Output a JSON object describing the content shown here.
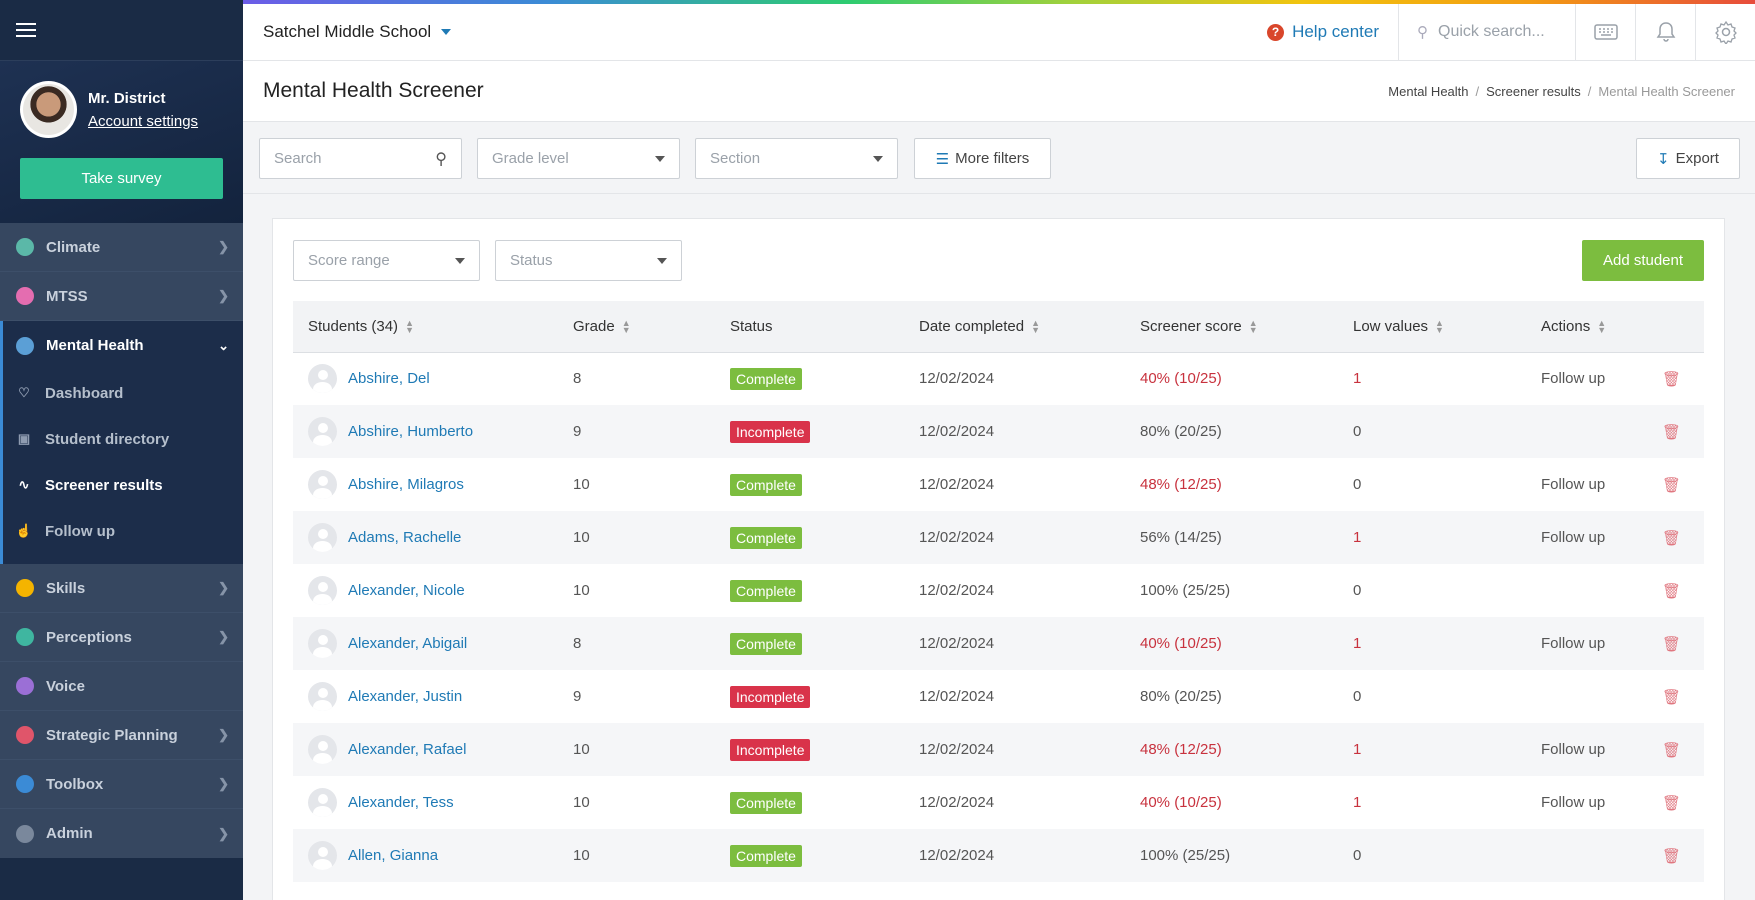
{
  "sidebar": {
    "user_name": "Mr. District",
    "account_link": "Account settings",
    "survey_button": "Take survey",
    "nav": [
      {
        "label": "Climate",
        "color": "#5bb8a8",
        "icon": "climate-icon"
      },
      {
        "label": "MTSS",
        "color": "#e46db0",
        "icon": "mtss-icon"
      },
      {
        "label": "Mental Health",
        "color": "#5b9fd6",
        "icon": "mental-health-icon"
      },
      {
        "label": "Skills",
        "color": "#f5b400",
        "icon": "skills-icon"
      },
      {
        "label": "Perceptions",
        "color": "#3fb6a0",
        "icon": "perceptions-icon"
      },
      {
        "label": "Voice",
        "color": "#9b6fd6",
        "icon": "voice-icon"
      },
      {
        "label": "Strategic Planning",
        "color": "#e0556a",
        "icon": "strategic-planning-icon"
      },
      {
        "label": "Toolbox",
        "color": "#3b8bd6",
        "icon": "toolbox-icon"
      },
      {
        "label": "Admin",
        "color": "#7a889c",
        "icon": "admin-icon"
      }
    ],
    "sub_nav": [
      {
        "label": "Dashboard"
      },
      {
        "label": "Student directory"
      },
      {
        "label": "Screener results"
      },
      {
        "label": "Follow up"
      }
    ]
  },
  "topbar": {
    "school": "Satchel Middle School",
    "help": "Help center",
    "search_placeholder": "Quick search..."
  },
  "page": {
    "title": "Mental Health Screener",
    "breadcrumb": [
      "Mental Health",
      "Screener results",
      "Mental Health Screener"
    ]
  },
  "filters": {
    "search_placeholder": "Search",
    "grade_level": "Grade level",
    "section": "Section",
    "more_filters": "More filters",
    "export": "Export",
    "score_range": "Score range",
    "status": "Status",
    "add_student": "Add student"
  },
  "table": {
    "headers": [
      "Students (34)",
      "Grade",
      "Status",
      "Date completed",
      "Screener score",
      "Low values",
      "Actions"
    ],
    "rows": [
      {
        "name": "Abshire, Del",
        "grade": "8",
        "status": "Complete",
        "date": "12/02/2024",
        "score": "40% (10/25)",
        "score_low": true,
        "low": "1",
        "action": "Follow up"
      },
      {
        "name": "Abshire, Humberto",
        "grade": "9",
        "status": "Incomplete",
        "date": "12/02/2024",
        "score": "80% (20/25)",
        "score_low": false,
        "low": "0",
        "action": ""
      },
      {
        "name": "Abshire, Milagros",
        "grade": "10",
        "status": "Complete",
        "date": "12/02/2024",
        "score": "48% (12/25)",
        "score_low": true,
        "low": "0",
        "action": "Follow up"
      },
      {
        "name": "Adams, Rachelle",
        "grade": "10",
        "status": "Complete",
        "date": "12/02/2024",
        "score": "56% (14/25)",
        "score_low": false,
        "low": "1",
        "action": "Follow up"
      },
      {
        "name": "Alexander, Nicole",
        "grade": "10",
        "status": "Complete",
        "date": "12/02/2024",
        "score": "100% (25/25)",
        "score_low": false,
        "low": "0",
        "action": ""
      },
      {
        "name": "Alexander, Abigail",
        "grade": "8",
        "status": "Complete",
        "date": "12/02/2024",
        "score": "40% (10/25)",
        "score_low": true,
        "low": "1",
        "action": "Follow up"
      },
      {
        "name": "Alexander, Justin",
        "grade": "9",
        "status": "Incomplete",
        "date": "12/02/2024",
        "score": "80% (20/25)",
        "score_low": false,
        "low": "0",
        "action": ""
      },
      {
        "name": "Alexander, Rafael",
        "grade": "10",
        "status": "Incomplete",
        "date": "12/02/2024",
        "score": "48% (12/25)",
        "score_low": true,
        "low": "1",
        "action": "Follow up"
      },
      {
        "name": "Alexander, Tess",
        "grade": "10",
        "status": "Complete",
        "date": "12/02/2024",
        "score": "40% (10/25)",
        "score_low": true,
        "low": "1",
        "action": "Follow up"
      },
      {
        "name": "Allen, Gianna",
        "grade": "10",
        "status": "Complete",
        "date": "12/02/2024",
        "score": "100% (25/25)",
        "score_low": false,
        "low": "0",
        "action": ""
      }
    ]
  }
}
